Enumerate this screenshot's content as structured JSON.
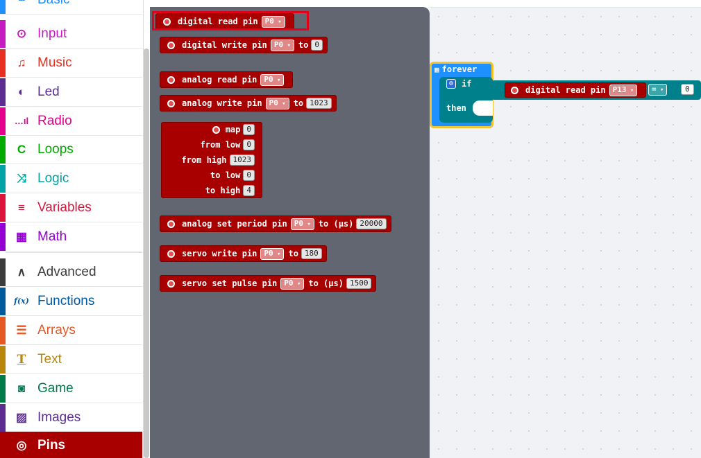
{
  "toolbox": {
    "categories": [
      {
        "label": "Basic",
        "icon": "grid-icon",
        "glyph": "▪▪▪",
        "color": "#1e90ff"
      },
      {
        "label": "Input",
        "icon": "input-icon",
        "glyph": "⊙",
        "color": "#c71bc2"
      },
      {
        "label": "Music",
        "icon": "headphones-icon",
        "glyph": "♫",
        "color": "#e63022"
      },
      {
        "label": "Led",
        "icon": "toggle-icon",
        "glyph": "◐",
        "color": "#5c2d91"
      },
      {
        "label": "Radio",
        "icon": "signal-bars-icon",
        "glyph": "…ıl",
        "color": "#e3008c"
      },
      {
        "label": "Loops",
        "icon": "loop-icon",
        "glyph": "C",
        "color": "#00aa00"
      },
      {
        "label": "Logic",
        "icon": "shuffle-icon",
        "glyph": "⤨",
        "color": "#00a4a6"
      },
      {
        "label": "Variables",
        "icon": "list-icon",
        "glyph": "≡",
        "color": "#dc143c"
      },
      {
        "label": "Math",
        "icon": "calculator-icon",
        "glyph": "▦",
        "color": "#9400d3"
      },
      {
        "label": "Advanced",
        "icon": "chevron-up-icon",
        "glyph": "∧",
        "color": "#3c3c3c"
      },
      {
        "label": "Functions",
        "icon": "function-icon",
        "glyph": "f(x)",
        "color": "#005a9e"
      },
      {
        "label": "Arrays",
        "icon": "array-list-icon",
        "glyph": "☰",
        "color": "#e65722"
      },
      {
        "label": "Text",
        "icon": "text-icon",
        "glyph": "T",
        "color": "#b8860b"
      },
      {
        "label": "Game",
        "icon": "gamepad-icon",
        "glyph": "◙",
        "color": "#007a4b"
      },
      {
        "label": "Images",
        "icon": "image-icon",
        "glyph": "▨",
        "color": "#5c2d91"
      },
      {
        "label": "Pins",
        "icon": "pins-icon",
        "glyph": "◎",
        "color": "#a80000",
        "selected": true
      }
    ]
  },
  "flyout": {
    "digital_read": {
      "text": "digital read pin",
      "pin": "P0"
    },
    "digital_write": {
      "text": "digital write pin",
      "pin": "P0",
      "to": "to",
      "value": "0"
    },
    "analog_read": {
      "text": "analog read pin",
      "pin": "P0"
    },
    "analog_write": {
      "text": "analog write pin",
      "pin": "P0",
      "to": "to",
      "value": "1023"
    },
    "map": {
      "title": "map",
      "value": "0",
      "from_low_label": "from low",
      "from_low": "0",
      "from_high_label": "from high",
      "from_high": "1023",
      "to_low_label": "to low",
      "to_low": "0",
      "to_high_label": "to high",
      "to_high": "4"
    },
    "analog_period": {
      "text": "analog set period pin",
      "pin": "P0",
      "to": "to (μs)",
      "value": "20000"
    },
    "servo_write": {
      "text": "servo write pin",
      "pin": "P0",
      "to": "to",
      "value": "180"
    },
    "servo_pulse": {
      "text": "servo set pulse pin",
      "pin": "P0",
      "to": "to (μs)",
      "value": "1500"
    }
  },
  "workspace": {
    "forever_label": "forever",
    "if_label": "if",
    "then_label": "then",
    "condition": {
      "text": "digital read pin",
      "pin": "P13",
      "operator": "=",
      "value": "0"
    }
  },
  "colors": {
    "pins": "#a80000",
    "loops_blue": "#1e90ff",
    "logic_teal": "#00808a",
    "highlight": "#e2001a"
  }
}
